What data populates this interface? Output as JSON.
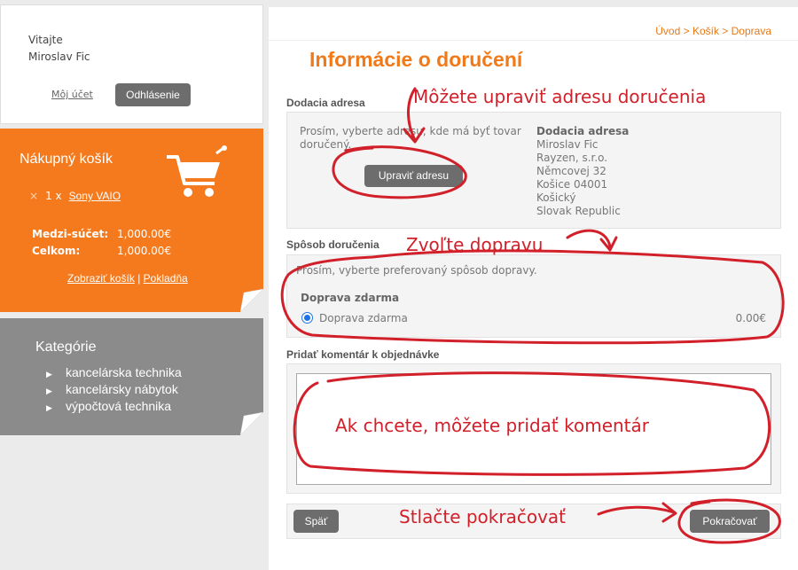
{
  "welcome": {
    "greeting": "Vitajte",
    "user_name": "Miroslav Fic",
    "account_link": "Môj účet",
    "logout_label": "Odhlásenie"
  },
  "cart": {
    "title": "Nákupný košík",
    "item_remove": "×",
    "item_qty": "1 x",
    "item_name": "Sony VAIO",
    "subtotal_label": "Medzi-súčet:",
    "subtotal_value": "1,000.00€",
    "total_label": "Celkom:",
    "total_value": "1,000.00€",
    "view_cart_link": "Zobraziť košík",
    "separator": "|",
    "checkout_link": "Pokladňa"
  },
  "categories": {
    "title": "Kategórie",
    "items": [
      "kancelárska technika",
      "kancelársky nábytok",
      "výpočtová technika"
    ]
  },
  "breadcrumb": "Úvod > Košík > Doprava",
  "page_title": "Informácie o doručení",
  "delivery_address": {
    "section_title": "Dodacia adresa",
    "prompt": "Prosím, vyberte adresu, kde má byť tovar doručený.",
    "edit_button": "Upraviť adresu",
    "address_heading": "Dodacia adresa",
    "lines": [
      "Miroslav Fic",
      "Rayzen, s.r.o.",
      "Němcovej 32",
      "Košice 04001",
      "Košický",
      "Slovak Republic"
    ]
  },
  "shipping": {
    "section_title": "Spôsob doručenia",
    "prompt": "Prosím, vyberte preferovaný spôsob dopravy.",
    "method_group": "Doprava zdarma",
    "method_label": "Doprava zdarma",
    "method_price": "0.00€"
  },
  "comment": {
    "section_title": "Pridať komentár k objednávke"
  },
  "navigation": {
    "back_label": "Späť",
    "continue_label": "Pokračovať"
  },
  "annotations": {
    "edit_address": "Môžete upraviť adresu doručenia",
    "choose_shipping": "Zvoľte dopravu",
    "add_comment": "Ak chcete, môžete pridať komentár",
    "press_continue": "Stlačte pokračovať",
    "color": "#d2202a"
  }
}
